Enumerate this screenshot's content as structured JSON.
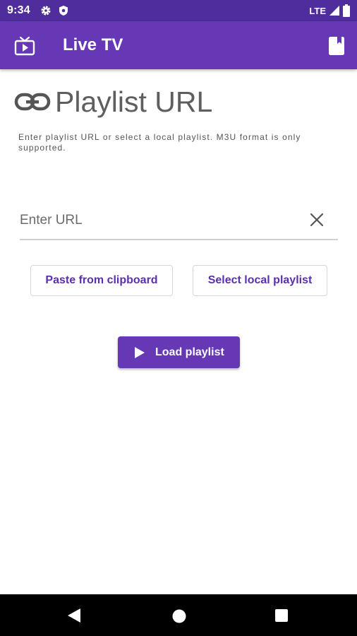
{
  "status_bar": {
    "time": "9:34",
    "network": "LTE",
    "icons": [
      "settings-icon",
      "shield-icon",
      "signal-icon",
      "battery-icon"
    ]
  },
  "app_bar": {
    "title": "Live TV",
    "left_icon": "tv-icon",
    "right_icon": "book-icon",
    "color": "#6638b6"
  },
  "section": {
    "icon": "link-icon",
    "title": "Playlist URL",
    "description": "Enter playlist URL or select a local playlist. M3U format is only supported."
  },
  "url_input": {
    "value": "",
    "placeholder": "Enter URL",
    "clear_icon": "close-icon"
  },
  "buttons": {
    "paste_label": "Paste from clipboard",
    "select_local_label": "Select local playlist",
    "load_label": "Load playlist",
    "load_icon": "play-icon"
  },
  "nav_bar": {
    "icons": [
      "back-icon",
      "home-icon",
      "recents-icon"
    ]
  },
  "colors": {
    "status_bar": "#4f2d9c",
    "primary": "#6638b6",
    "accent_text": "#5b2fb1"
  }
}
